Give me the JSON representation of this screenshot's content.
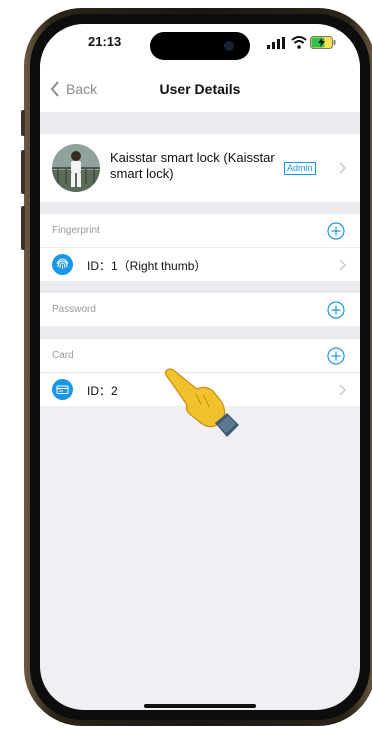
{
  "status_bar": {
    "time": "21:13"
  },
  "nav": {
    "back_label": "Back",
    "title": "User Details"
  },
  "user": {
    "name": "Kaisstar smart lock (Kaisstar smart lock)",
    "badge": "Admin"
  },
  "sections": {
    "fingerprint": {
      "label": "Fingerprint",
      "items": [
        {
          "label": "ID：1（Right thumb）"
        }
      ]
    },
    "password": {
      "label": "Password"
    },
    "card": {
      "label": "Card",
      "items": [
        {
          "label": "ID：2"
        }
      ]
    }
  },
  "icons": {
    "back": "chevron-left-icon",
    "add": "plus-circle-icon",
    "row_arrow": "chevron-right-icon",
    "fingerprint": "fingerprint-icon",
    "card": "card-icon",
    "pointer": "pointing-hand-icon"
  },
  "colors": {
    "accent": "#1a96e6",
    "background": "#f0f0f4",
    "hint": "#9a9aa0"
  }
}
